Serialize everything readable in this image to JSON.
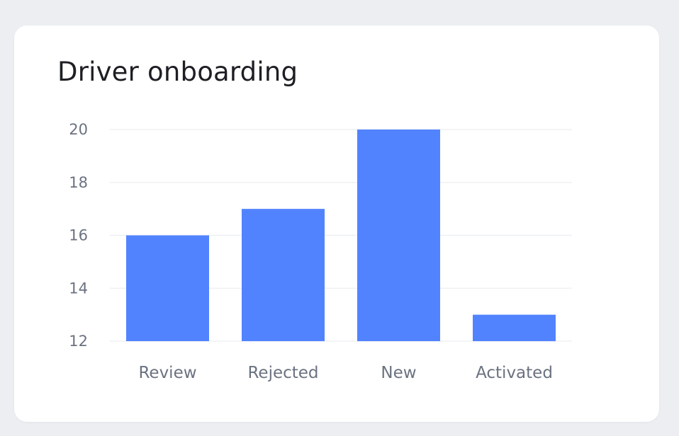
{
  "card": {
    "title": "Driver onboarding"
  },
  "chart_data": {
    "type": "bar",
    "title": "Driver onboarding",
    "categories": [
      "Review",
      "Rejected",
      "New",
      "Activated"
    ],
    "values": [
      16,
      17,
      20,
      13
    ],
    "ylim": [
      12,
      20
    ],
    "yticks": [
      12,
      14,
      16,
      18,
      20
    ],
    "xlabel": "",
    "ylabel": "",
    "grid": true,
    "legend": "none",
    "bar_color": "#5283ff",
    "grid_color": "#eef0f3",
    "label_color": "#6b7280"
  }
}
